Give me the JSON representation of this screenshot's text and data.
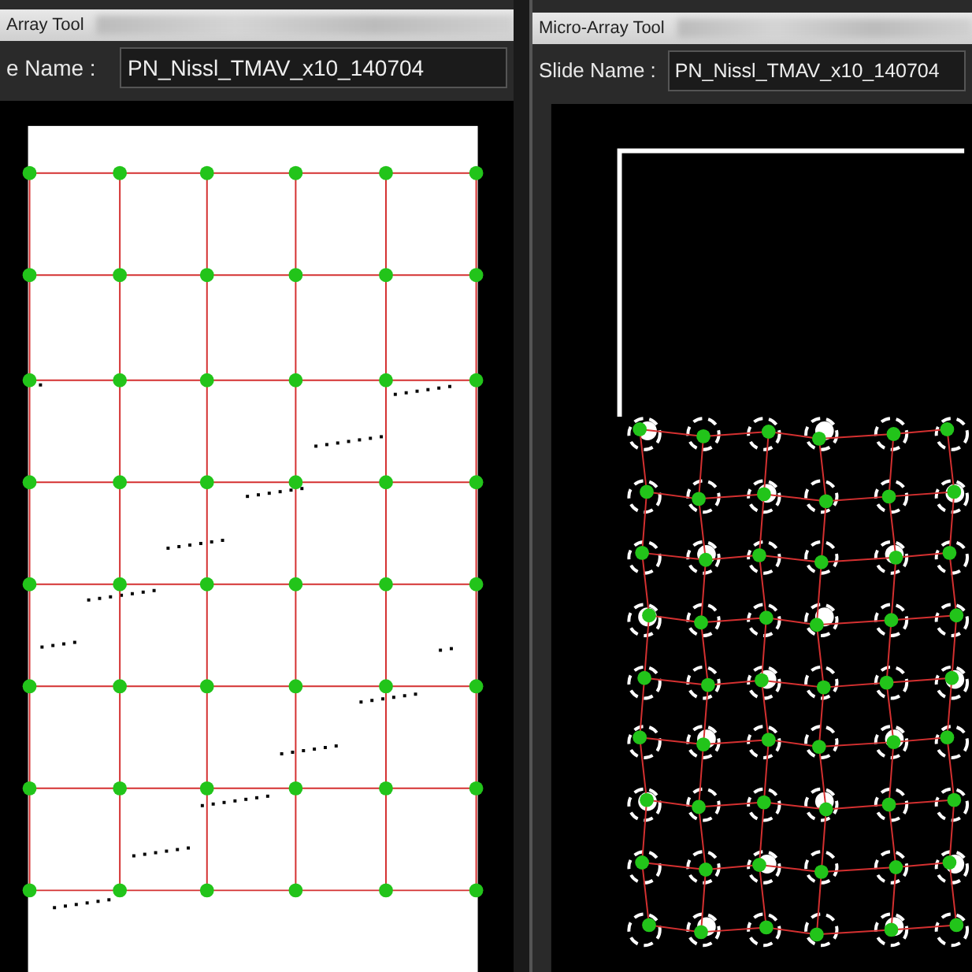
{
  "windows": [
    {
      "title": "Array Tool",
      "slide_label": "e Name :",
      "slide_value": "PN_Nissl_TMAV_x10_140704",
      "kind": "binary"
    },
    {
      "title": "Micro-Array Tool",
      "slide_label": "Slide Name :",
      "slide_value": "PN_Nissl_TMAV_x10_140704",
      "kind": "inverted"
    }
  ]
}
